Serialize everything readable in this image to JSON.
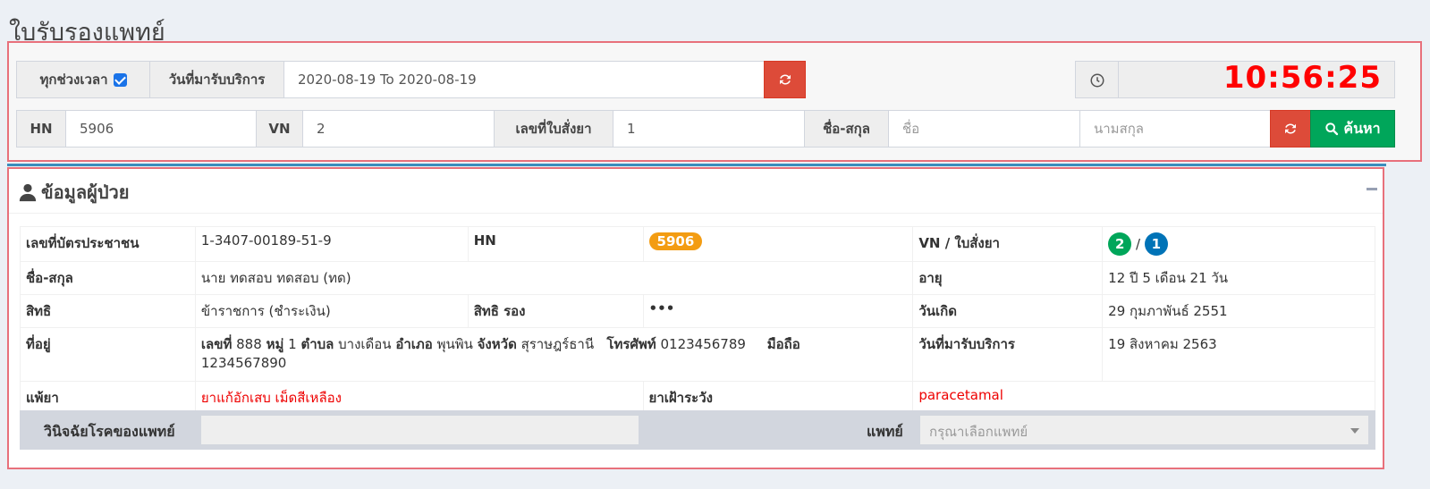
{
  "page": {
    "title": "ใบรับรองแพทย์"
  },
  "search": {
    "all_time_label": "ทุกช่วงเวลา",
    "all_time_checked": true,
    "service_date_label": "วันที่มารับบริการ",
    "date_range": "2020-08-19 To 2020-08-19",
    "clock_time": "10:56:25",
    "hn_label": "HN",
    "hn_value": "5906",
    "vn_label": "VN",
    "vn_value": "2",
    "rx_label": "เลขที่ใบสั่งยา",
    "rx_value": "1",
    "name_label": "ชื่อ-สกุล",
    "first_name_placeholder": "ชื่อ",
    "last_name_placeholder": "นามสกุล",
    "search_button": "ค้นหา"
  },
  "patient": {
    "panel_title": "ข้อมูลผู้ป่วย",
    "id_card_label": "เลขที่บัตรประชาชน",
    "id_card_value": "1-3407-00189-51-9",
    "hn_label": "HN",
    "hn_badge": "5906",
    "vn_rx_label": "VN / ใบสั่งยา",
    "vn_badge": "2",
    "vn_rx_sep": "/",
    "rx_badge": "1",
    "name_label": "ชื่อ-สกุล",
    "name_value": "นาย ทดสอบ ทดสอบ (ทด)",
    "age_label": "อายุ",
    "age_value": "12 ปี 5 เดือน 21 วัน",
    "right_label": "สิทธิ",
    "right_value": "ข้าราชการ (ชำระเงิน)",
    "sub_right_label": "สิทธิ รอง",
    "sub_right_value": "•••",
    "birth_label": "วันเกิด",
    "birth_value": "29 กุมภาพันธ์ 2551",
    "address_label": "ที่อยู่",
    "addr_no_label": "เลขที่",
    "addr_no": "888",
    "addr_moo_label": "หมู่",
    "addr_moo": "1",
    "addr_tambon_label": "ตำบล",
    "addr_tambon": "บางเดือน",
    "addr_amphoe_label": "อำเภอ",
    "addr_amphoe": "พุนพิน",
    "addr_province_label": "จังหวัด",
    "addr_province": "สุราษฎร์ธานี",
    "addr_postcode": "1234567890",
    "phone_label": "โทรศัพท์",
    "phone_value": "0123456789",
    "mobile_label": "มือถือ",
    "visit_date_label": "วันที่มารับบริการ",
    "visit_date_value": "19 สิงหาคม 2563",
    "allergy_label": "แพ้ยา",
    "allergy_value": "ยาแก้อักเสบ เม็ดสีเหลือง",
    "watch_label": "ยาเฝ้าระวัง",
    "watch_value": "paracetamal",
    "diagnosis_label": "วินิจฉัยโรคของแพทย์",
    "doctor_label": "แพทย์",
    "doctor_placeholder": "กรุณาเลือกแพทย์"
  },
  "colors": {
    "clock": "#ff0000",
    "panel_border": "#e8707b",
    "accent_blue": "#3c8dbc",
    "search_green": "#00a65a",
    "refresh_red": "#dd4b39"
  }
}
